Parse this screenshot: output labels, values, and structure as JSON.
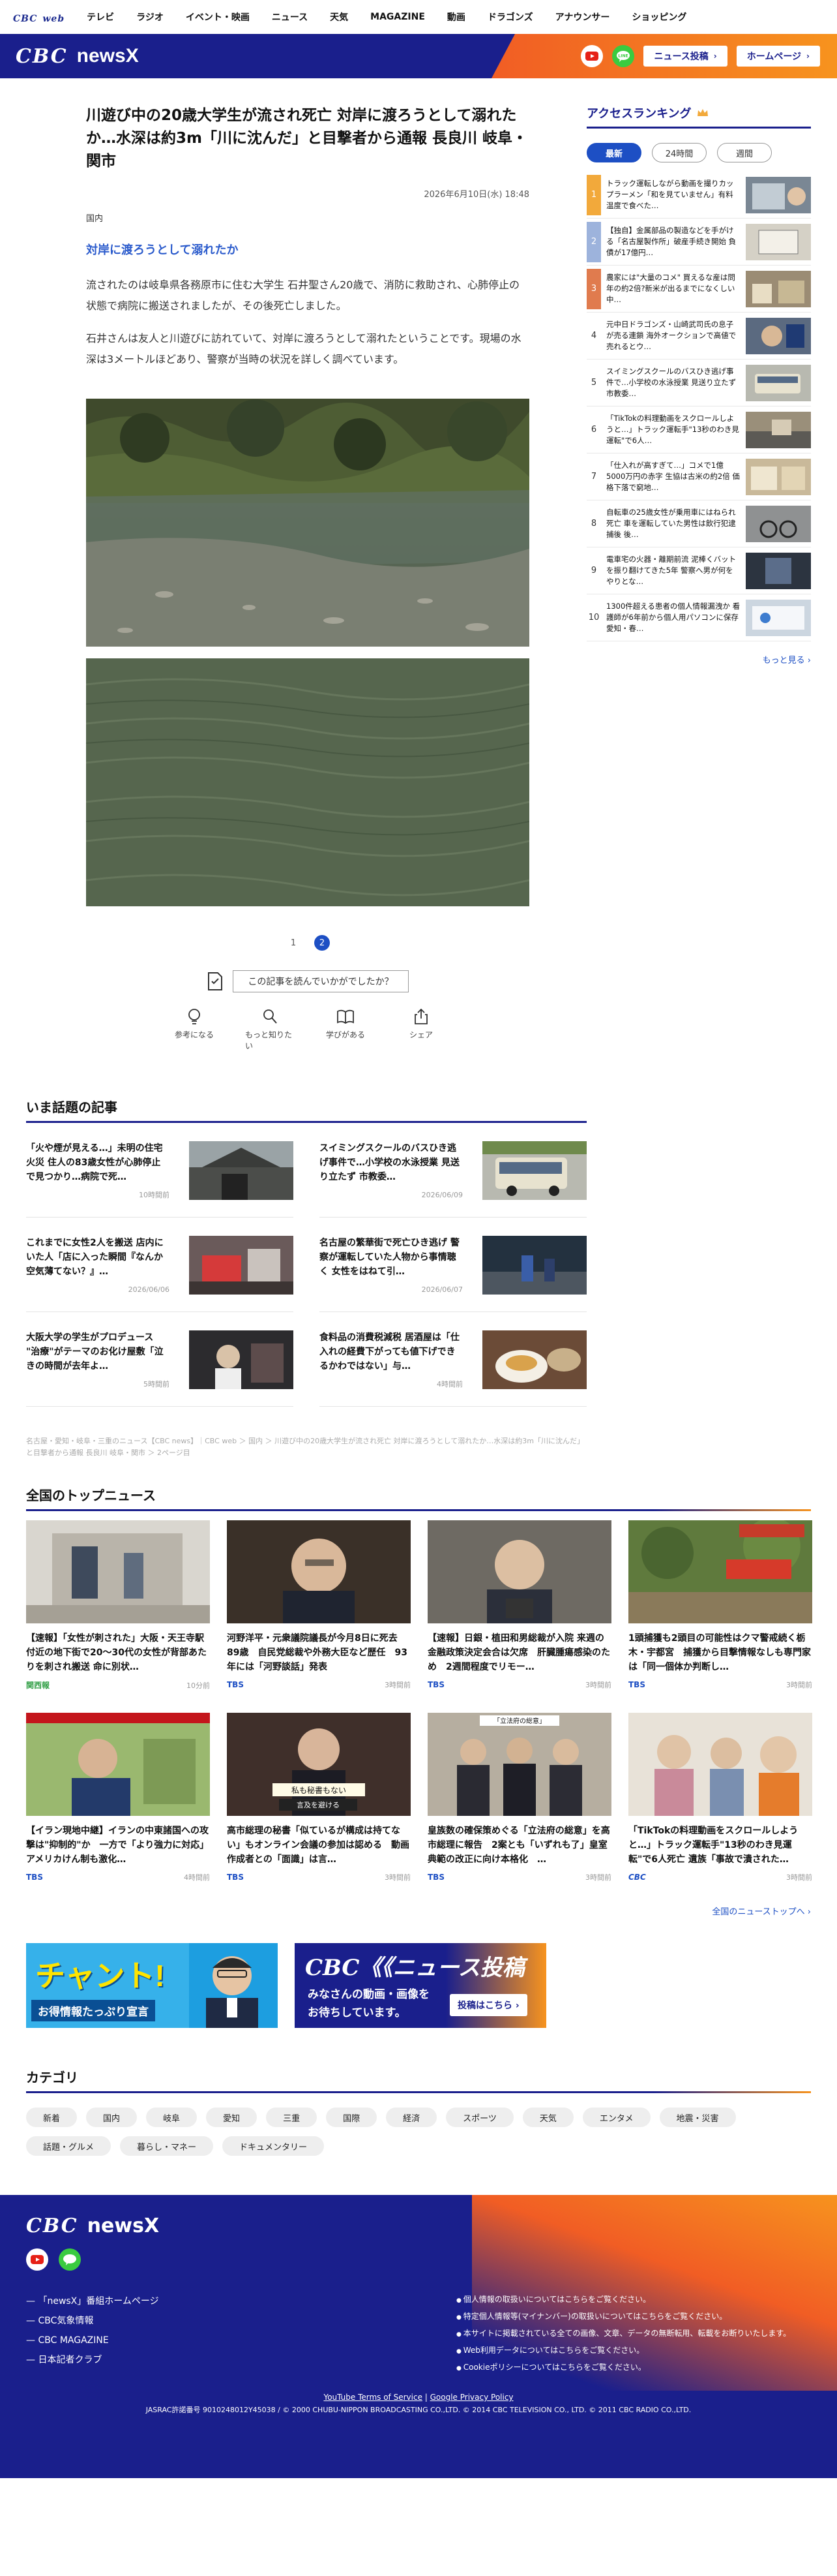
{
  "site_nav": {
    "logo_main": "CBC",
    "logo_sub": "web",
    "items": [
      "テレビ",
      "ラジオ",
      "イベント・映画",
      "ニュース",
      "天気",
      "MAGAZINE",
      "動画",
      "ドラゴンズ",
      "アナウンサー",
      "ショッピング"
    ]
  },
  "header": {
    "brand_cbc": "CBC",
    "brand_news": "newsX",
    "news_post": "ニュース投稿",
    "homepage": "ホームページ",
    "arrow": "›"
  },
  "article": {
    "title": "川遊び中の20歳大学生が流され死亡 対岸に渡ろうとして溺れたか…水深は約3m「川に沈んだ」と目撃者から通報 長良川 岐阜・関市",
    "date": "2026年6月10日(水) 18:48",
    "category": "国内",
    "subheading": "対岸に渡ろうとして溺れたか",
    "p1": "流されたのは岐阜県各務原市に住む大学生 石井聖さん20歳で、消防に救助され、心肺停止の状態で病院に搬送されましたが、その後死亡しました。",
    "p2": "石井さんは友人と川遊びに訪れていて、対岸に渡ろうとして溺れたということです。現場の水深は3メートルほどあり、警察が当時の状況を詳しく調べています。",
    "pages": [
      "1",
      "2"
    ],
    "feedback": "この記事を読んでいかがでしたか？",
    "reactions": [
      "参考になる",
      "もっと知りたい",
      "学びがある",
      "シェア"
    ]
  },
  "trending": {
    "title": "いま話題の記事",
    "items": [
      {
        "text": "「火や煙が見える…」未明の住宅火災 住人の83歳女性が心肺停止で見つかり…病院で死…",
        "date": "10時間前"
      },
      {
        "text": "スイミングスクールのバスひき逃げ事件で…小学校の水泳授業 見送り立たず 市教委…",
        "date": "2026/06/09"
      },
      {
        "text": "これまでに女性2人を搬送 店内にいた人「店に入った瞬間『なんか空気薄てない？』…",
        "date": "2026/06/06"
      },
      {
        "text": "名古屋の繁華街で死亡ひき逃げ 警察が運転していた人物から事情聴く 女性をはねて引…",
        "date": "2026/06/07"
      },
      {
        "text": "大阪大学の学生がプロデュース \"治療\"がテーマのお化け屋敷「泣きの時間が去年よ…",
        "date": "5時間前"
      },
      {
        "text": "食料品の消費税減税 居酒屋は「仕入れの経費下がっても値下げできるかわではない」与…",
        "date": "4時間前"
      }
    ]
  },
  "breadcrumb": "名古屋・愛知・岐阜・三重のニュース【CBC news】｜CBC web ＞ 国内 ＞ 川遊び中の20歳大学生が流され死亡 対岸に渡ろうとして溺れたか…水深は約3m「川に沈んだ」と目撃者から通報 長良川 岐阜・関市 ＞ 2ページ目",
  "ranking": {
    "title": "アクセスランキング",
    "tabs": [
      "最新",
      "24時間",
      "週間"
    ],
    "items": [
      {
        "no": "1",
        "text": "トラック運転しながら動画を撮りカップラーメン「和を見ていません」有料温度で食べた…"
      },
      {
        "no": "2",
        "text": "【独自】金属部品の製造などを手がける「名古屋製作所」破産手続き開始 負債が17億円…"
      },
      {
        "no": "3",
        "text": "農家には\"大量のコメ\" 買えるな産は問年の約2倍?新米が出るまでになくしい 中…"
      },
      {
        "no": "4",
        "text": "元中日ドラゴンズ・山崎武司氏の息子が売る連鎖 海外オークションで高値で売れるとウ…"
      },
      {
        "no": "5",
        "text": "スイミングスクールのバスひき逃げ事件で…小学校の水泳授業 見送り立たず 市教委…"
      },
      {
        "no": "6",
        "text": "「TikTokの料理動画をスクロールしようと…」トラック運転手\"13秒のわき見運転\"で6人…"
      },
      {
        "no": "7",
        "text": "「仕入れが高すぎて…」コメで1億5000万円の赤字 生協は古米の約2倍 価格下落で窮地…"
      },
      {
        "no": "8",
        "text": "自転車の25歳女性が乗用車にはねられ死亡 車を運転していた男性は飲行犯逮捕後 後…"
      },
      {
        "no": "9",
        "text": "電車宅の火器・離期前流 泥棒くバットを振り翻けてきた5年 警察へ男が何をやりとな…"
      },
      {
        "no": "10",
        "text": "1300件超える患者の個人情報漏洩か 看護師が6年前から個人用パソコンに保存 愛知・春…"
      }
    ],
    "more": "もっと見る ›"
  },
  "national": {
    "title": "全国のトップニュース",
    "items": [
      {
        "text": "【速報】「女性が刺された」大阪・天王寺駅付近の地下街で20〜30代の女性が背部あたりを刺され搬送 命に別状…",
        "src": "関西報",
        "time": "10分前"
      },
      {
        "text": "河野洋平・元衆議院議長が今月8日に死去　89歳　自民党総裁や外務大臣など歴任　93年には「河野談話」発表",
        "src": "TBS",
        "time": "3時間前"
      },
      {
        "text": "【速報】日銀・植田和男総裁が入院 来週の金融政策決定会合は欠席　肝臓腫瘍感染のため　2週間程度でリモー…",
        "src": "TBS",
        "time": "3時間前"
      },
      {
        "text": "1頭捕獲も2頭目の可能性はクマ警戒続く栃木・宇都宮　捕獲から目撃情報なしも専門家は「同一個体か判断し…",
        "src": "TBS",
        "time": "3時間前"
      },
      {
        "text": "【イラン現地中継】イランの中東諸国への攻撃は\"抑制的\"か　一方で「より強力に対応」アメリカけん制も激化…",
        "src": "TBS",
        "time": "4時間前"
      },
      {
        "text": "高市総理の秘書「似ているが構成は持てない」もオンライン会議の参加は認める　動画作成者との「面識」は言…",
        "src": "TBS",
        "time": "3時間前"
      },
      {
        "text": "皇族数の確保策めぐる「立法府の総意」を高市総理に報告　2案とも「いずれも了」皇室典範の改正に向け本格化　…",
        "src": "TBS",
        "time": "3時間前"
      },
      {
        "text": "「TikTokの料理動画をスクロールしようと…」トラック運転手\"13秒のわき見運転\"で6人死亡 遺族「事故で潰された…",
        "src": "CBC",
        "time": "3時間前"
      }
    ],
    "more": "全国のニューストップへ ›",
    "photo_labels": [
      "私も秘書もない",
      "言及を避ける",
      "「立法府の総意」"
    ]
  },
  "banners": {
    "chant_title": "チャント!",
    "chant_sub": "お得情報たっぷり宣言",
    "post_title": "CBC《《ニュース投稿",
    "post_sub1": "みなさんの動画・画像を",
    "post_sub2": "お待ちしています。",
    "post_btn": "投稿はこちら ›"
  },
  "categories": {
    "title": "カテゴリ",
    "chips": [
      "新着",
      "国内",
      "岐阜",
      "愛知",
      "三重",
      "国際",
      "経済",
      "スポーツ",
      "天気",
      "エンタメ",
      "地震・災害",
      "話題・グルメ",
      "暮らし・マネー",
      "ドキュメンタリー"
    ]
  },
  "footer": {
    "brand_cbc": "CBC",
    "brand_news": "newsX",
    "links": [
      "「newsX」番組ホームページ",
      "CBC気象情報",
      "CBC MAGAZINE",
      "日本記者クラブ"
    ],
    "policies": [
      "個人情報の取扱いについてはこちらをご覧ください。",
      "特定個人情報等(マイナンバー)の取扱いについてはこちらをご覧ください。",
      "本サイトに掲載されている全ての画像、文章、データの無断転用、転載をお断りいたします。",
      "Web利用データについてはこちらをご覧ください。",
      "Cookieポリシーについてはこちらをご覧ください。"
    ],
    "tos": "YouTube Terms of Service",
    "privacy": "Google Privacy Policy",
    "copyright": "JASRAC許諾番号 9010248012Y45038 / © 2000 CHUBU-NIPPON BROADCASTING CO.,LTD. © 2014 CBC TELEVISION CO., LTD. © 2011 CBC RADIO CO.,LTD."
  }
}
